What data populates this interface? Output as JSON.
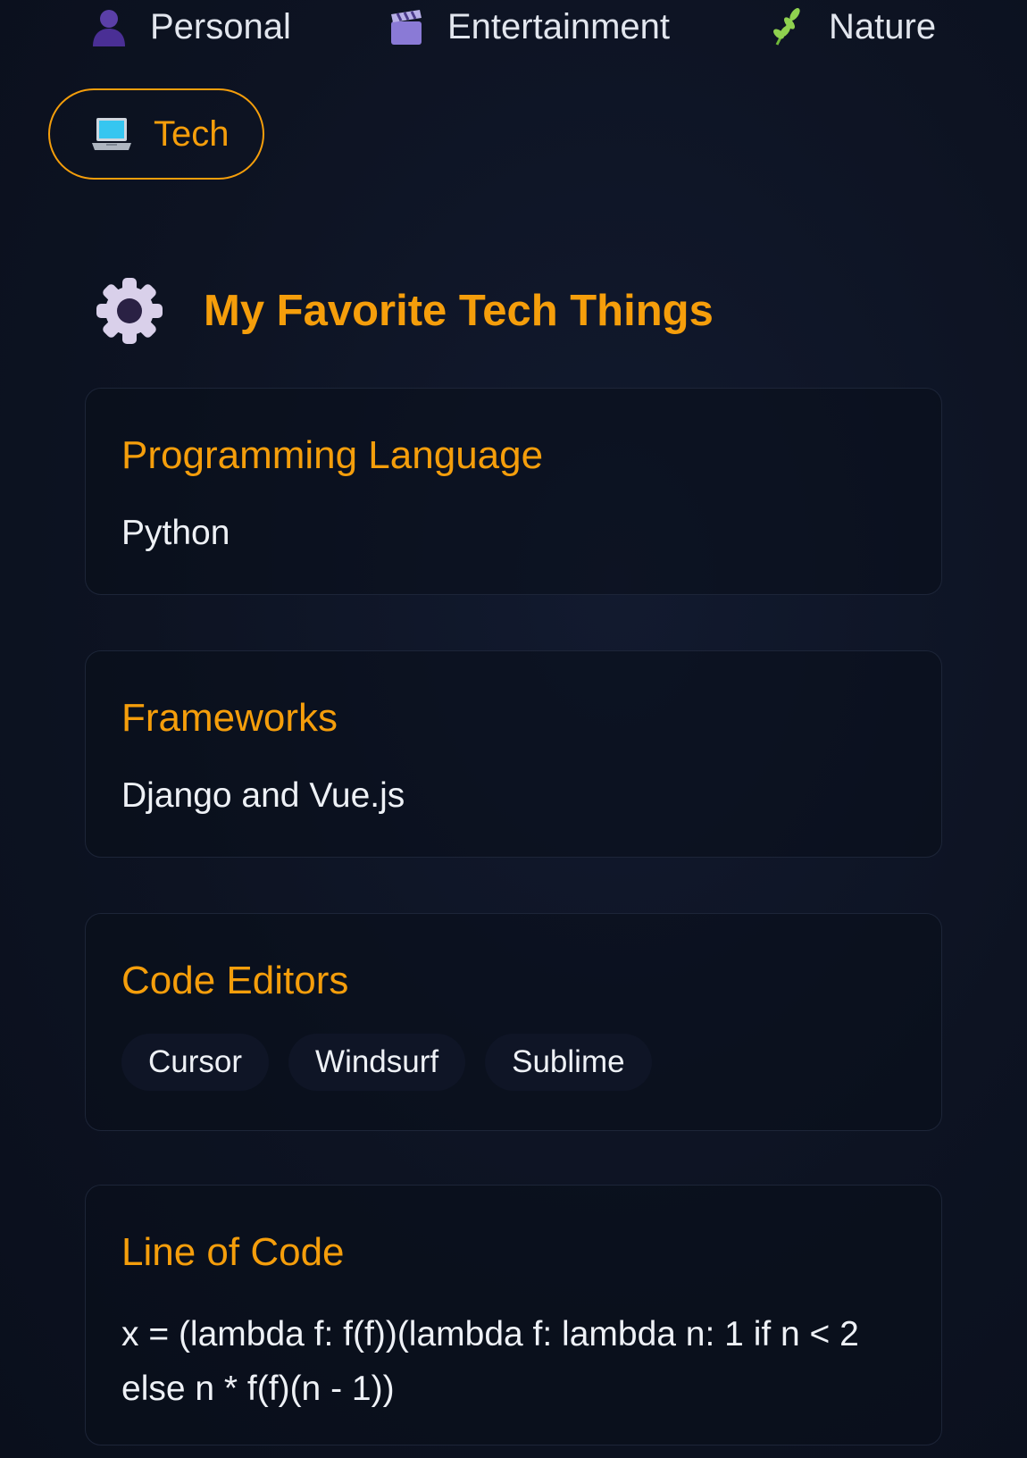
{
  "tabs": [
    {
      "label": "Personal",
      "icon": "person-icon"
    },
    {
      "label": "Entertainment",
      "icon": "clapper-board-icon"
    },
    {
      "label": "Nature",
      "icon": "herb-icon"
    }
  ],
  "active_tab": {
    "label": "Tech",
    "icon": "laptop-icon"
  },
  "section": {
    "title": "My Favorite Tech Things",
    "icon": "gear-icon"
  },
  "cards": {
    "programming_language": {
      "title": "Programming Language",
      "value": "Python"
    },
    "frameworks": {
      "title": "Frameworks",
      "value": "Django and Vue.js"
    },
    "code_editors": {
      "title": "Code Editors",
      "items": [
        "Cursor",
        "Windsurf",
        "Sublime"
      ]
    },
    "line_of_code": {
      "title": "Line of Code",
      "value": "x = (lambda f: f(f))(lambda f: lambda n: 1 if n < 2 else n * f(f)(n - 1))"
    }
  },
  "colors": {
    "accent": "#f59e0b",
    "background": "#0d1322",
    "text": "#eef1f6"
  }
}
